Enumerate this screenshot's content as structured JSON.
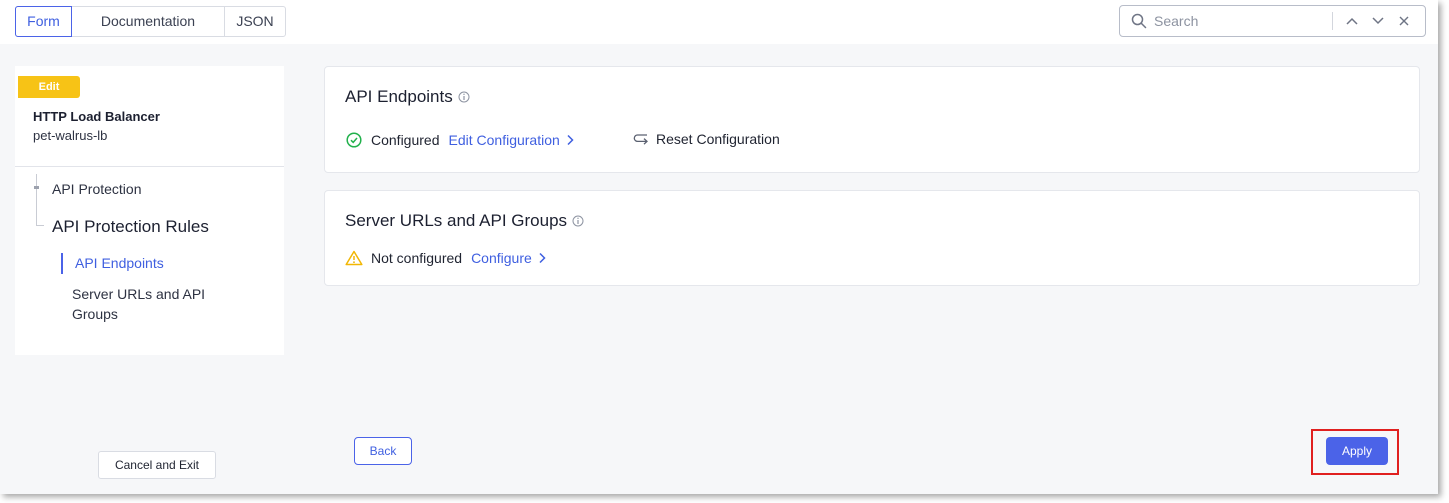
{
  "tabs": [
    {
      "label": "Form",
      "active": true
    },
    {
      "label": "Documentation",
      "active": false
    },
    {
      "label": "JSON",
      "active": false
    }
  ],
  "search": {
    "placeholder": "Search",
    "value": "",
    "icons": [
      "search-icon",
      "chevron-up-icon",
      "chevron-down-icon",
      "close-icon"
    ]
  },
  "sidebar": {
    "badge": "Edit",
    "object_type": "HTTP Load Balancer",
    "object_name": "pet-walrus-lb",
    "nav": {
      "api_protection": "API Protection",
      "api_protection_rules": "API Protection Rules",
      "api_endpoints": "API Endpoints",
      "server_urls": "Server URLs and API Groups"
    },
    "cancel_label": "Cancel and Exit"
  },
  "sections": {
    "api_endpoints": {
      "title": "API Endpoints",
      "status": "Configured",
      "status_icon": "check-circle-icon",
      "action": "Edit Configuration",
      "reset": "Reset Configuration"
    },
    "server_urls": {
      "title": "Server URLs and API Groups",
      "status": "Not configured",
      "status_icon": "warning-icon",
      "action": "Configure"
    }
  },
  "footer": {
    "back_label": "Back",
    "apply_label": "Apply"
  },
  "colors": {
    "accent": "#4b63e8",
    "badge": "#f7c316",
    "success": "#22b14c",
    "warning": "#f2b705",
    "highlight": "#e02020"
  }
}
